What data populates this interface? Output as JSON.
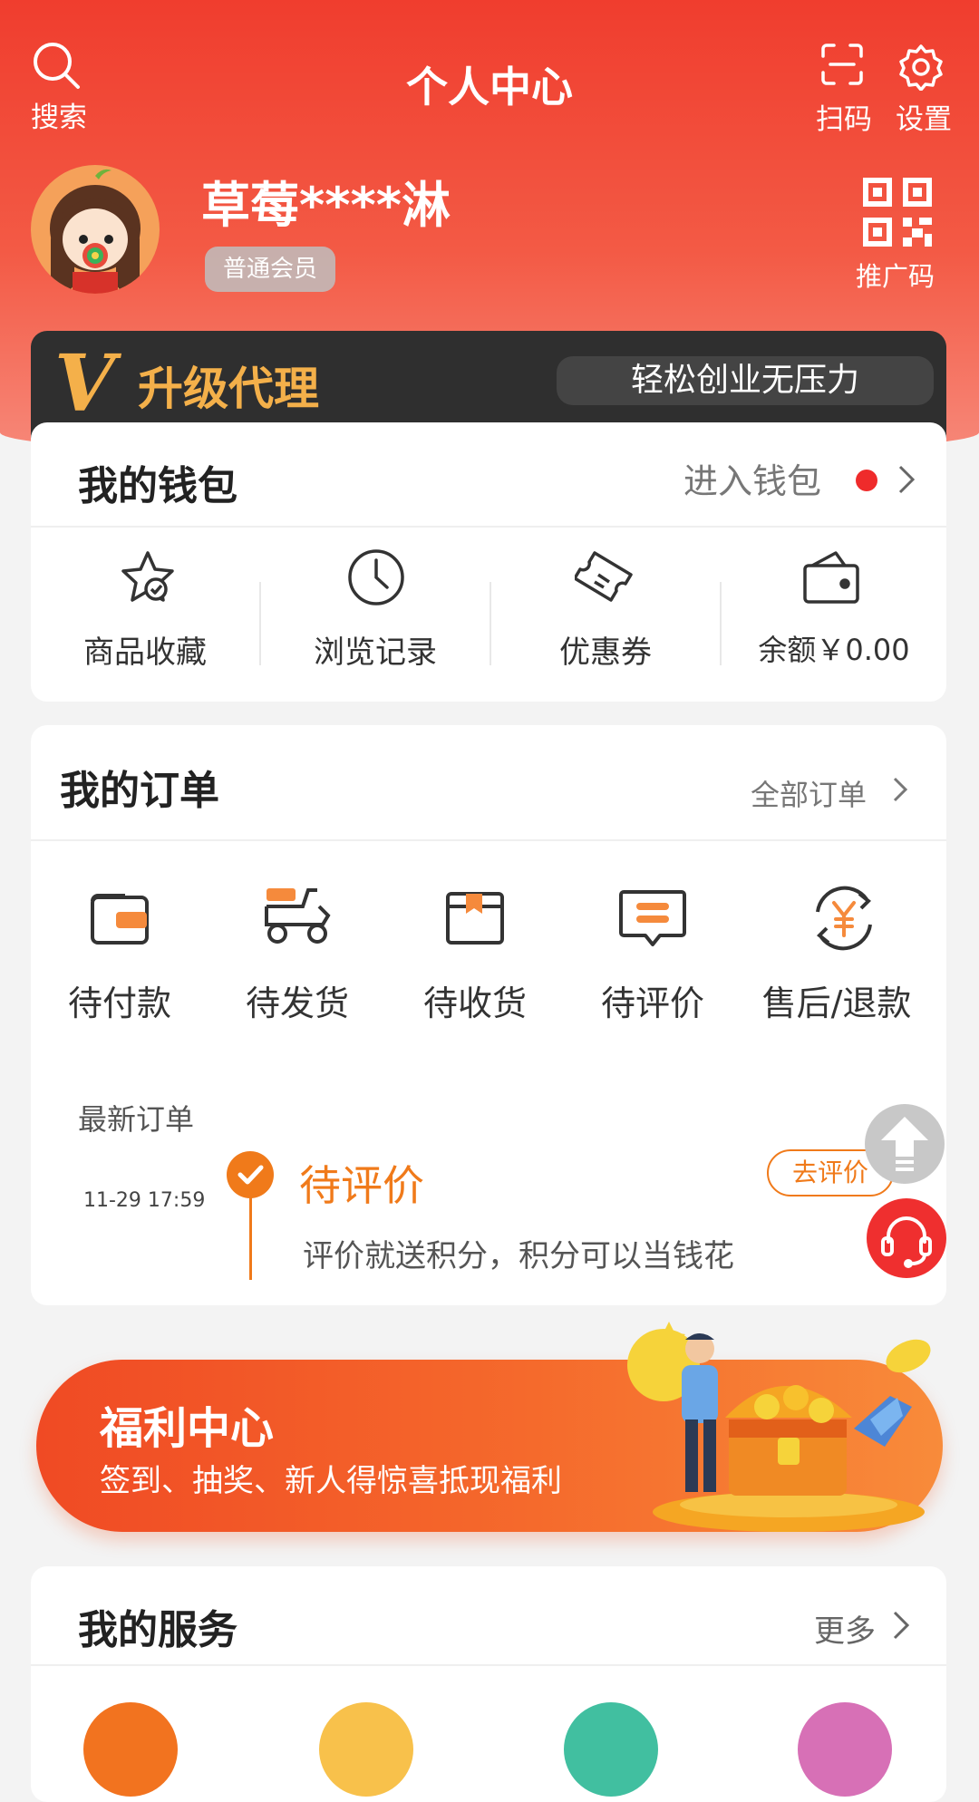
{
  "header": {
    "title": "个人中心",
    "search_label": "搜索",
    "scan_label": "扫码",
    "settings_label": "设置"
  },
  "profile": {
    "username": "草莓****淋",
    "member_level": "普通会员",
    "promo_code_label": "推广码"
  },
  "agent_banner": {
    "logo_letter": "V",
    "title": "升级代理",
    "slogan": "轻松创业无压力"
  },
  "wallet": {
    "title": "我的钱包",
    "enter_label": "进入钱包",
    "items": [
      {
        "icon": "star-check-icon",
        "label": "商品收藏"
      },
      {
        "icon": "clock-icon",
        "label": "浏览记录"
      },
      {
        "icon": "ticket-icon",
        "label": "优惠券"
      },
      {
        "icon": "wallet-icon",
        "label": "余额￥0.00"
      }
    ]
  },
  "orders": {
    "title": "我的订单",
    "all_label": "全部订单",
    "items": [
      {
        "icon": "wallet-card-icon",
        "label": "待付款"
      },
      {
        "icon": "delivery-scooter-icon",
        "label": "待发货"
      },
      {
        "icon": "package-box-icon",
        "label": "待收货"
      },
      {
        "icon": "comment-icon",
        "label": "待评价"
      },
      {
        "icon": "refund-yen-icon",
        "label": "售后/退款"
      }
    ],
    "latest_label": "最新订单",
    "latest": {
      "time": "11-29 17:59",
      "status": "待评价",
      "action": "去评价",
      "description": "评价就送积分，积分可以当钱花"
    }
  },
  "welfare_banner": {
    "title": "福利中心",
    "subtitle": "签到、抽奖、新人得惊喜抵现福利"
  },
  "services": {
    "title": "我的服务",
    "more_label": "更多"
  },
  "colors": {
    "brand_red": "#f03d2e",
    "accent_orange": "#f07a1a",
    "gold": "#f4b04a",
    "dark_banner": "#2f2f2f"
  }
}
